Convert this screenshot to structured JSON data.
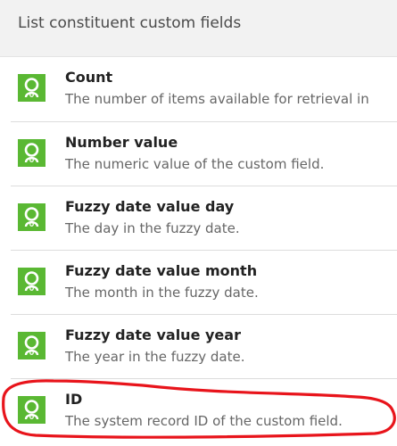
{
  "header": {
    "title": "List constituent custom fields"
  },
  "items": [
    {
      "title": "Count",
      "description": "The number of items available for retrieval in",
      "icon": "constituent-connector-icon"
    },
    {
      "title": "Number value",
      "description": "The numeric value of the custom field.",
      "icon": "constituent-connector-icon"
    },
    {
      "title": "Fuzzy date value day",
      "description": "The day in the fuzzy date.",
      "icon": "constituent-connector-icon"
    },
    {
      "title": "Fuzzy date value month",
      "description": "The month in the fuzzy date.",
      "icon": "constituent-connector-icon"
    },
    {
      "title": "Fuzzy date value year",
      "description": "The year in the fuzzy date.",
      "icon": "constituent-connector-icon"
    },
    {
      "title": "ID",
      "description": "The system record ID of the custom field.",
      "icon": "constituent-connector-icon"
    }
  ],
  "colors": {
    "icon_green": "#5ab833",
    "annotation_red": "#e8141b",
    "header_bg": "#f2f2f2"
  }
}
